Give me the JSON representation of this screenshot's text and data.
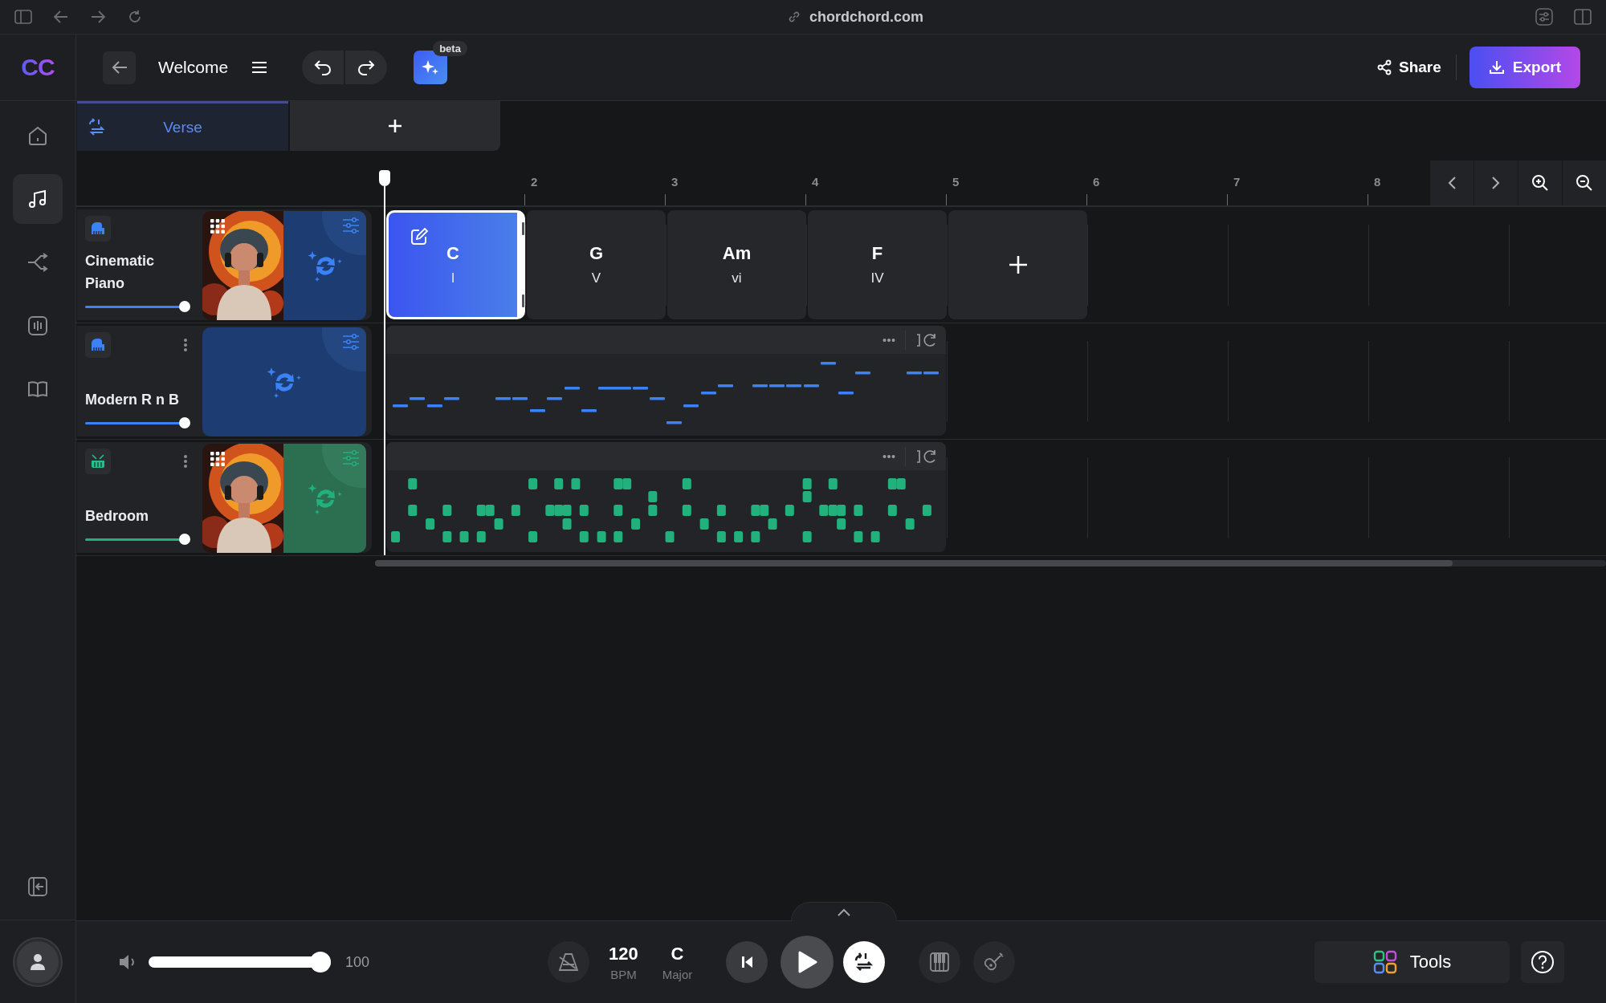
{
  "browser": {
    "url": "chordchord.com"
  },
  "logo": "CC",
  "sidebar": {
    "items": [
      {
        "selected": false
      },
      {
        "selected": true
      },
      {
        "selected": false
      },
      {
        "selected": false
      },
      {
        "selected": false
      }
    ]
  },
  "header": {
    "title": "Welcome",
    "badge": "beta",
    "share": "Share",
    "export": "Export"
  },
  "sections": [
    {
      "label": "Verse",
      "selected": true
    }
  ],
  "ruler": [
    "2",
    "3",
    "4",
    "5",
    "6",
    "7",
    "8"
  ],
  "tracks": [
    {
      "name": "Cinematic Piano",
      "kind": "piano",
      "menu": false,
      "picture": true,
      "level": 1
    },
    {
      "name": "Modern R n B",
      "kind": "piano",
      "menu": true,
      "picture": false,
      "level": 1
    },
    {
      "name": "Bedroom",
      "kind": "drums",
      "menu": true,
      "picture": true,
      "level": 1
    }
  ],
  "chords": [
    {
      "name": "C",
      "numeral": "I",
      "selected": true
    },
    {
      "name": "G",
      "numeral": "V",
      "selected": false
    },
    {
      "name": "Am",
      "numeral": "vi",
      "selected": false
    },
    {
      "name": "F",
      "numeral": "IV",
      "selected": false
    }
  ],
  "transport": {
    "volume": {
      "level": 1,
      "reading": "100"
    },
    "tempo": "120",
    "tempo_unit": "BPM",
    "key": "C",
    "mode": "Major",
    "loop_on": true
  },
  "tools": "Tools"
}
